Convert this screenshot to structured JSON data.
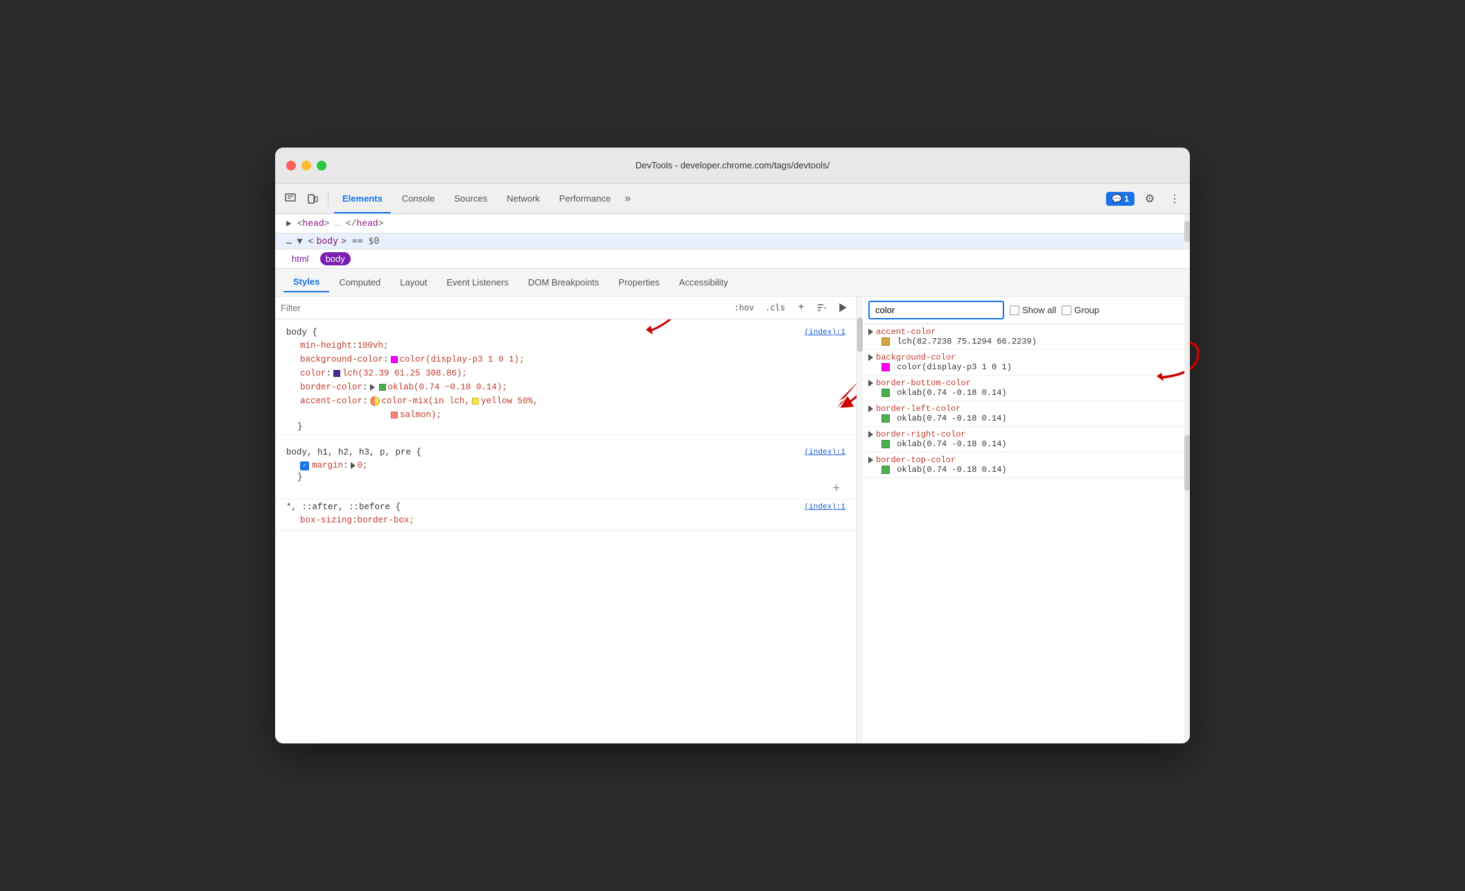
{
  "window": {
    "title": "DevTools - developer.chrome.com/tags/devtools/"
  },
  "toolbar": {
    "tabs": [
      "Elements",
      "Console",
      "Sources",
      "Network",
      "Performance"
    ],
    "active_tab": "Elements",
    "more_label": "»",
    "chat_badge": "💬 1",
    "settings_label": "⚙",
    "more_menu_label": "⋮"
  },
  "dom": {
    "head_line": "▶ <head> … </head>",
    "body_line": "… ▼ <body> == $0"
  },
  "breadcrumbs": [
    "html",
    "body"
  ],
  "sub_tabs": [
    "Styles",
    "Computed",
    "Layout",
    "Event Listeners",
    "DOM Breakpoints",
    "Properties",
    "Accessibility"
  ],
  "styles": {
    "filter_placeholder": "Filter",
    "hov_label": ":hov",
    "cls_label": ".cls",
    "rules": [
      {
        "selector": "body {",
        "source": "(index):1",
        "properties": [
          {
            "name": "min-height",
            "colon": ": ",
            "value": "100vh;",
            "swatch": null,
            "checkbox": false,
            "triangle": false
          },
          {
            "name": "background-color",
            "colon": ": ",
            "value": "color(display-p3 1 0 1);",
            "swatch": "#ff00ff",
            "checkbox": false,
            "triangle": false
          },
          {
            "name": "color",
            "colon": ": ",
            "value": "lch(32.39 61.25 308.86);",
            "swatch": "#4b2d8a",
            "checkbox": false,
            "triangle": false
          },
          {
            "name": "border-color",
            "colon": ": ",
            "value": "oklab(0.74 −0.18 0.14);",
            "swatch": "#4caf50",
            "checkbox": false,
            "triangle": true
          },
          {
            "name": "accent-color",
            "colon": ": ",
            "value": "color-mix(in lch, ",
            "swatch_mixed": true,
            "checkbox": false,
            "triangle": false,
            "extra": "yellow 50%, salmon);",
            "yellow_swatch": "#f5e642"
          }
        ],
        "closing": "}"
      },
      {
        "selector": "body, h1, h2, h3, p, pre {",
        "source": "(index):1",
        "properties": [
          {
            "name": "margin",
            "colon": ": ",
            "value": "0;",
            "checkbox": true,
            "triangle": true
          }
        ],
        "closing": "}",
        "has_add": true
      },
      {
        "selector": "*, ::after, ::before {",
        "source": "(index):1",
        "properties": [
          {
            "name": "box-sizing",
            "colon": ": ",
            "value": "border-box;",
            "checkbox": false,
            "triangle": false
          }
        ]
      }
    ]
  },
  "computed": {
    "search_value": "color",
    "show_all_label": "Show all",
    "group_label": "Group",
    "items": [
      {
        "prop": "accent-color",
        "value": "lch(82.7238 75.1294 66.2239)",
        "swatch": "#d4a83a"
      },
      {
        "prop": "background-color",
        "value": "color(display-p3 1 0 1)",
        "swatch": "#ff00ff"
      },
      {
        "prop": "border-bottom-color",
        "value": "oklab(0.74 -0.18 0.14)",
        "swatch": "#4caf50"
      },
      {
        "prop": "border-left-color",
        "value": "oklab(0.74 -0.18 0.14)",
        "swatch": "#4caf50"
      },
      {
        "prop": "border-right-color",
        "value": "oklab(0.74 -0.18 0.14)",
        "swatch": "#4caf50"
      },
      {
        "prop": "border-top-color",
        "value": "oklab(0.74 -0.18 0.14)",
        "swatch": "#4caf50"
      }
    ]
  },
  "arrows": {
    "right_arrow_1": "↙",
    "right_arrow_2": "↙"
  }
}
